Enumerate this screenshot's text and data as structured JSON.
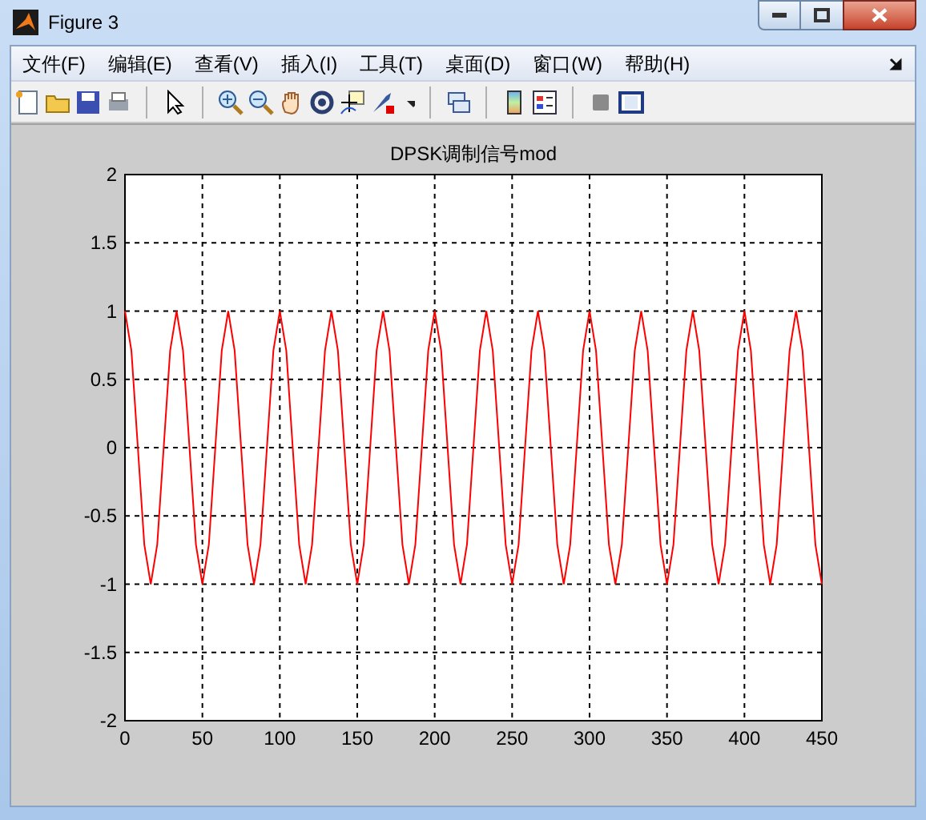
{
  "window": {
    "title": "Figure 3"
  },
  "menu": [
    "文件(F)",
    "编辑(E)",
    "查看(V)",
    "插入(I)",
    "工具(T)",
    "桌面(D)",
    "窗口(W)",
    "帮助(H)"
  ],
  "figure": {
    "chart_data": {
      "type": "line",
      "grid": true,
      "title": "DPSK调制信号mod",
      "xlim": [
        0,
        450
      ],
      "ylim": [
        -2,
        2
      ],
      "xticks": [
        0,
        50,
        100,
        150,
        200,
        250,
        300,
        350,
        400,
        450
      ],
      "yticks": [
        -2,
        -1.5,
        -1,
        -0.5,
        0,
        0.5,
        1,
        1.5,
        2
      ],
      "x": [
        0,
        4.17,
        8.33,
        12.5,
        16.67,
        20.83,
        25,
        29.17,
        33.33,
        37.5,
        41.67,
        45.83,
        50,
        54.17,
        58.33,
        62.5,
        66.67,
        70.83,
        75,
        79.17,
        83.33,
        87.5,
        91.67,
        95.83,
        100,
        104.17,
        108.33,
        112.5,
        116.67,
        120.83,
        125,
        129.17,
        133.33,
        137.5,
        141.67,
        145.83,
        150,
        154.17,
        158.33,
        162.5,
        166.67,
        170.83,
        175,
        179.17,
        183.33,
        187.5,
        191.67,
        195.83,
        200,
        204.17,
        208.33,
        212.5,
        216.67,
        220.83,
        225,
        229.17,
        233.33,
        237.5,
        241.67,
        245.83,
        250,
        254.17,
        258.33,
        262.5,
        266.67,
        270.83,
        275,
        279.17,
        283.33,
        287.5,
        291.67,
        295.83,
        300,
        304.17,
        308.33,
        312.5,
        316.67,
        320.83,
        325,
        329.17,
        333.33,
        337.5,
        341.67,
        345.83,
        350,
        354.17,
        358.33,
        362.5,
        366.67,
        370.83,
        375,
        379.17,
        383.33,
        387.5,
        391.67,
        395.83,
        400,
        404.17,
        408.33,
        412.5,
        416.67,
        420.83,
        425,
        429.17,
        433.33,
        437.5,
        441.67,
        445.83,
        450
      ],
      "series": [
        {
          "color": "#ff0000",
          "values": [
            1,
            0.71,
            0,
            -0.71,
            -1,
            -0.71,
            0,
            0.71,
            1,
            0.71,
            0,
            -0.71,
            -1,
            -0.71,
            0,
            0.71,
            1,
            0.71,
            0,
            -0.71,
            -1,
            -0.71,
            0,
            0.71,
            1,
            0.71,
            0,
            -0.71,
            -1,
            -0.71,
            0,
            0.71,
            1,
            0.71,
            0,
            -0.71,
            -1,
            -0.71,
            0,
            0.71,
            1,
            0.71,
            0,
            -0.71,
            -1,
            -0.71,
            0,
            0.71,
            1,
            0.71,
            0,
            -0.71,
            -1,
            -0.71,
            0,
            0.71,
            1,
            0.71,
            0,
            -0.71,
            -1,
            -0.71,
            0,
            0.71,
            1,
            0.71,
            0,
            -0.71,
            -1,
            -0.71,
            0,
            0.71,
            1,
            0.71,
            0,
            -0.71,
            -1,
            -0.71,
            0,
            0.71,
            1,
            0.71,
            0,
            -0.71,
            -1,
            -0.71,
            0,
            0.71,
            1,
            0.71,
            0,
            -0.71,
            -1,
            -0.71,
            0,
            0.71,
            1,
            0.71,
            0,
            -0.71,
            -1,
            -0.71,
            0,
            0.71,
            1,
            0.71,
            0,
            -0.71,
            -1
          ]
        }
      ]
    }
  }
}
